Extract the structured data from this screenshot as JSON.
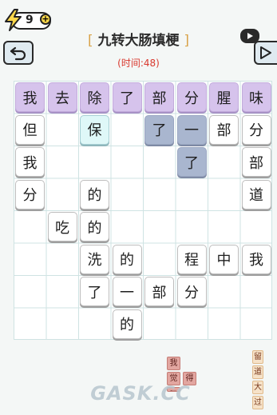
{
  "energy": {
    "value": "9",
    "plus": "+"
  },
  "title": {
    "text": "九转大肠填梗",
    "left_bracket": "[",
    "right_bracket": "]"
  },
  "timer": "(时间:48)",
  "board": {
    "cells": [
      {
        "r": 0,
        "c": 0,
        "ch": "我",
        "style": "purple"
      },
      {
        "r": 0,
        "c": 1,
        "ch": "去",
        "style": "purple"
      },
      {
        "r": 0,
        "c": 2,
        "ch": "除",
        "style": "purple"
      },
      {
        "r": 0,
        "c": 3,
        "ch": "了",
        "style": "purple"
      },
      {
        "r": 0,
        "c": 4,
        "ch": "部",
        "style": "purple"
      },
      {
        "r": 0,
        "c": 5,
        "ch": "分",
        "style": "purple"
      },
      {
        "r": 0,
        "c": 6,
        "ch": "腥",
        "style": "purple"
      },
      {
        "r": 0,
        "c": 7,
        "ch": "味",
        "style": "purple"
      },
      {
        "r": 1,
        "c": 0,
        "ch": "但",
        "style": "white"
      },
      {
        "r": 1,
        "c": 2,
        "ch": "保",
        "style": "cyan"
      },
      {
        "r": 1,
        "c": 4,
        "ch": "了",
        "style": "bluegray"
      },
      {
        "r": 1,
        "c": 5,
        "ch": "一",
        "style": "bluegray"
      },
      {
        "r": 1,
        "c": 6,
        "ch": "部",
        "style": "white"
      },
      {
        "r": 1,
        "c": 7,
        "ch": "分",
        "style": "white"
      },
      {
        "r": 2,
        "c": 0,
        "ch": "我",
        "style": "white"
      },
      {
        "r": 2,
        "c": 5,
        "ch": "了",
        "style": "bluegray"
      },
      {
        "r": 2,
        "c": 7,
        "ch": "部",
        "style": "white"
      },
      {
        "r": 3,
        "c": 0,
        "ch": "分",
        "style": "white"
      },
      {
        "r": 3,
        "c": 2,
        "ch": "的",
        "style": "white"
      },
      {
        "r": 3,
        "c": 7,
        "ch": "道",
        "style": "white"
      },
      {
        "r": 4,
        "c": 1,
        "ch": "吃",
        "style": "white"
      },
      {
        "r": 4,
        "c": 2,
        "ch": "的",
        "style": "white"
      },
      {
        "r": 5,
        "c": 2,
        "ch": "洗",
        "style": "white"
      },
      {
        "r": 5,
        "c": 3,
        "ch": "的",
        "style": "white"
      },
      {
        "r": 5,
        "c": 5,
        "ch": "程",
        "style": "white"
      },
      {
        "r": 5,
        "c": 6,
        "ch": "中",
        "style": "white"
      },
      {
        "r": 5,
        "c": 7,
        "ch": "我",
        "style": "white"
      },
      {
        "r": 6,
        "c": 2,
        "ch": "了",
        "style": "white"
      },
      {
        "r": 6,
        "c": 3,
        "ch": "一",
        "style": "white"
      },
      {
        "r": 6,
        "c": 4,
        "ch": "部",
        "style": "white"
      },
      {
        "r": 6,
        "c": 5,
        "ch": "分",
        "style": "white"
      },
      {
        "r": 7,
        "c": 3,
        "ch": "的",
        "style": "white"
      }
    ]
  },
  "side_tags": [
    "留",
    "道",
    "大",
    "过"
  ],
  "watermark_chars": [
    "我",
    "觉",
    "得",
    "肠"
  ],
  "brand": "GASK.CC",
  "colors": {
    "purple": "#d6c3ec",
    "bluegray": "#a9b6cf",
    "cyan": "#dff8f8",
    "timer": "#d9392f",
    "title_bracket": "#d9a44a"
  }
}
